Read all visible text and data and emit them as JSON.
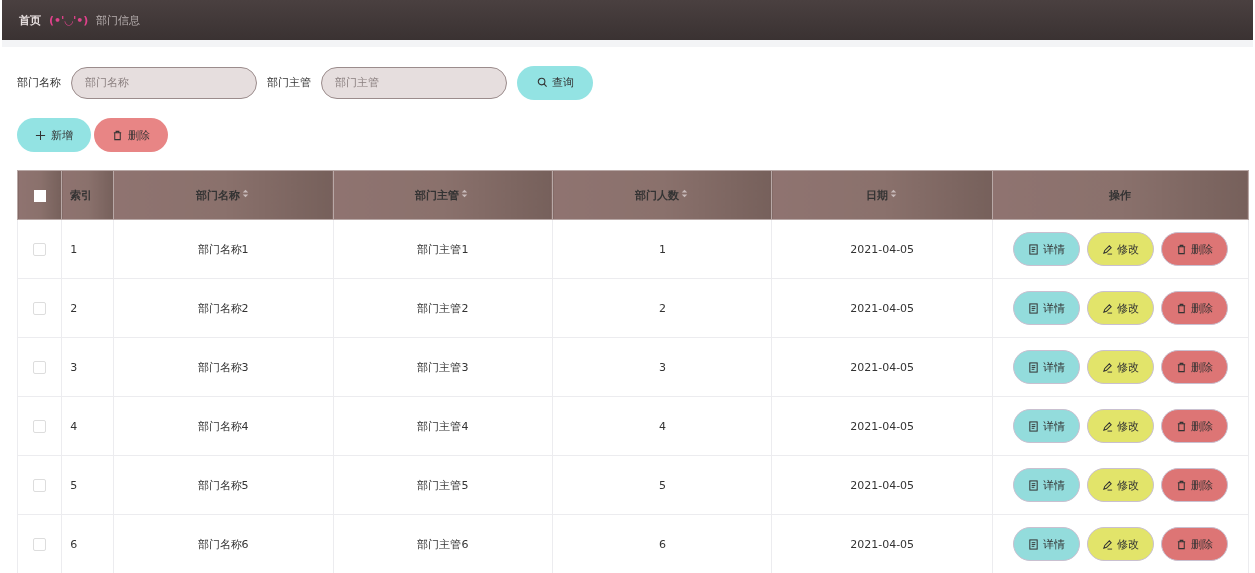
{
  "breadcrumb": {
    "home": "首页",
    "emoticon": "(•'◡'•)",
    "current": "部门信息"
  },
  "search": {
    "fields": [
      {
        "label": "部门名称",
        "placeholder": "部门名称"
      },
      {
        "label": "部门主管",
        "placeholder": "部门主管"
      }
    ],
    "button": "查询"
  },
  "actions": [
    {
      "kind": "add",
      "label": "新增"
    },
    {
      "kind": "delete",
      "label": "删除"
    }
  ],
  "table": {
    "select_all_checked": false,
    "columns": [
      {
        "label": "索引",
        "sortable": false
      },
      {
        "label": "部门名称",
        "sortable": true
      },
      {
        "label": "部门主管",
        "sortable": true
      },
      {
        "label": "部门人数",
        "sortable": true
      },
      {
        "label": "日期",
        "sortable": true
      },
      {
        "label": "操作",
        "sortable": false
      }
    ],
    "rows": [
      {
        "checked": false,
        "cells": [
          "1",
          "部门名称1",
          "部门主管1",
          "1",
          "2021-04-05"
        ],
        "buttons": [
          {
            "kind": "detail",
            "label": "详情"
          },
          {
            "kind": "edit",
            "label": "修改"
          },
          {
            "kind": "delete",
            "label": "删除"
          }
        ]
      },
      {
        "checked": false,
        "cells": [
          "2",
          "部门名称2",
          "部门主管2",
          "2",
          "2021-04-05"
        ],
        "buttons": [
          {
            "kind": "detail",
            "label": "详情"
          },
          {
            "kind": "edit",
            "label": "修改"
          },
          {
            "kind": "delete",
            "label": "删除"
          }
        ]
      },
      {
        "checked": false,
        "cells": [
          "3",
          "部门名称3",
          "部门主管3",
          "3",
          "2021-04-05"
        ],
        "buttons": [
          {
            "kind": "detail",
            "label": "详情"
          },
          {
            "kind": "edit",
            "label": "修改"
          },
          {
            "kind": "delete",
            "label": "删除"
          }
        ]
      },
      {
        "checked": false,
        "cells": [
          "4",
          "部门名称4",
          "部门主管4",
          "4",
          "2021-04-05"
        ],
        "buttons": [
          {
            "kind": "detail",
            "label": "详情"
          },
          {
            "kind": "edit",
            "label": "修改"
          },
          {
            "kind": "delete",
            "label": "删除"
          }
        ]
      },
      {
        "checked": false,
        "cells": [
          "5",
          "部门名称5",
          "部门主管5",
          "5",
          "2021-04-05"
        ],
        "buttons": [
          {
            "kind": "detail",
            "label": "详情"
          },
          {
            "kind": "edit",
            "label": "修改"
          },
          {
            "kind": "delete",
            "label": "删除"
          }
        ]
      },
      {
        "checked": false,
        "cells": [
          "6",
          "部门名称6",
          "部门主管6",
          "6",
          "2021-04-05"
        ],
        "buttons": [
          {
            "kind": "detail",
            "label": "详情"
          },
          {
            "kind": "edit",
            "label": "修改"
          },
          {
            "kind": "delete",
            "label": "删除"
          }
        ]
      }
    ]
  }
}
